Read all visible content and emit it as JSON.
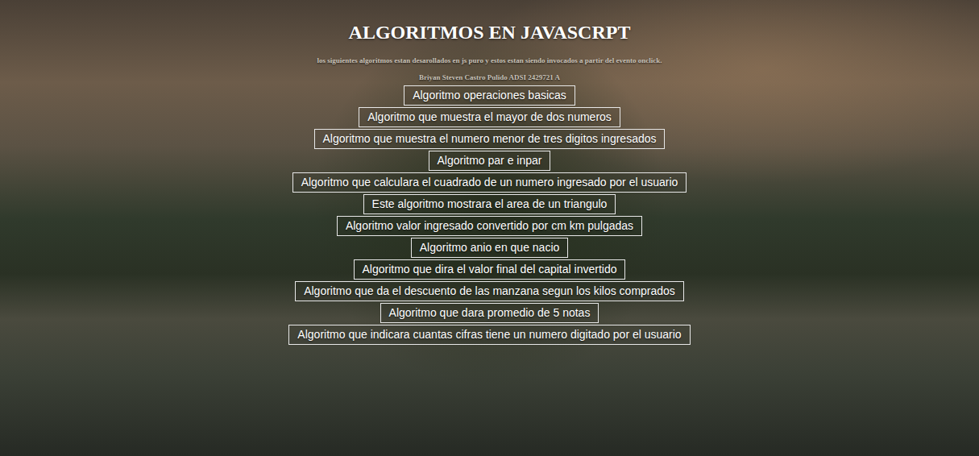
{
  "page": {
    "title": "ALGORITMOS EN JAVASCRPT",
    "subtitle": "los siguientes algoritmos estan desarollados en js puro y estos estan siendo invocados a partir del evento onclick.",
    "author": "Briyan Steven Castro Pulido ADSI 2429721 A"
  },
  "buttons": [
    {
      "label": "Algoritmo operaciones basicas"
    },
    {
      "label": "Algoritmo que muestra el mayor de dos numeros"
    },
    {
      "label": "Algoritmo que muestra el numero menor de tres digitos ingresados"
    },
    {
      "label": "Algoritmo par e inpar"
    },
    {
      "label": "Algoritmo que calculara el cuadrado de un numero ingresado por el usuario"
    },
    {
      "label": "Este algoritmo mostrara el area de un triangulo"
    },
    {
      "label": "Algoritmo valor ingresado convertido por cm km pulgadas"
    },
    {
      "label": "Algoritmo anio en que nacio"
    },
    {
      "label": "Algoritmo que dira el valor final del capital invertido"
    },
    {
      "label": "Algoritmo que da el descuento de las manzana segun los kilos comprados"
    },
    {
      "label": "Algoritmo que dara promedio de 5 notas"
    },
    {
      "label": "Algoritmo que indicara cuantas cifras tiene un numero digitado por el usuario"
    }
  ]
}
